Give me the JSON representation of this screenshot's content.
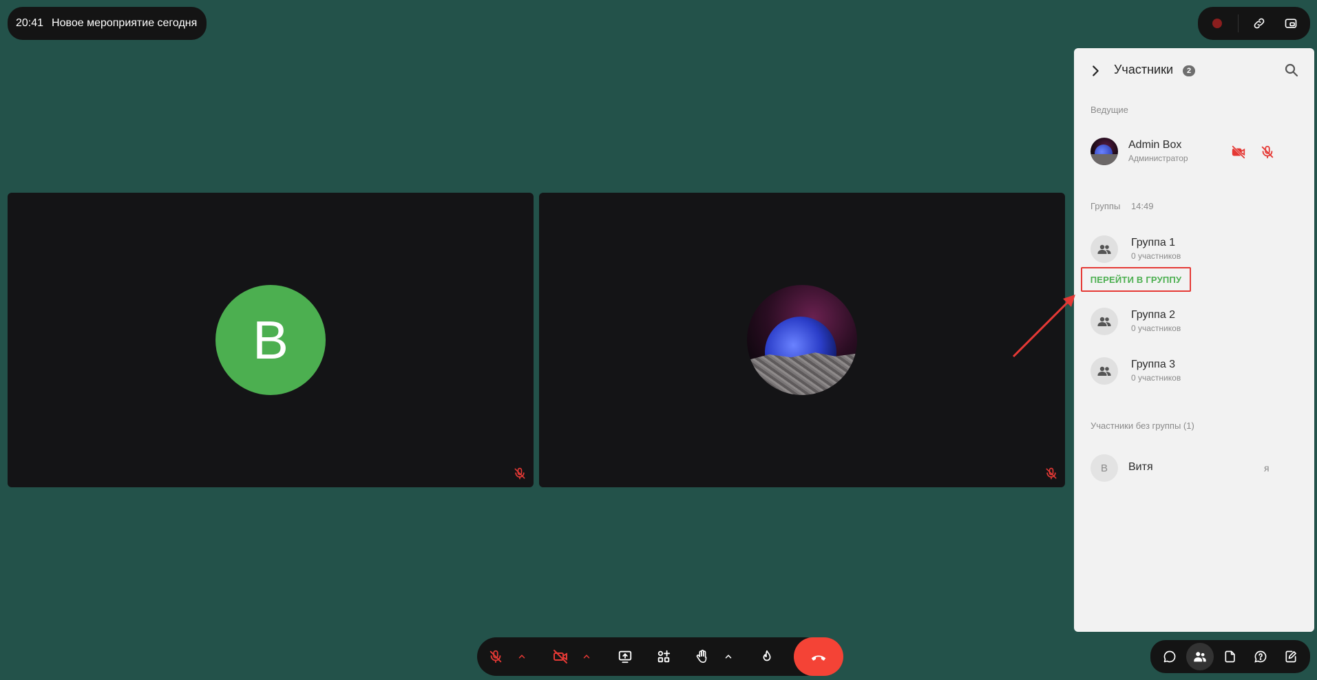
{
  "header": {
    "time": "20:41",
    "title": "Новое мероприятие сегодня"
  },
  "tiles": [
    {
      "avatar_letter": "B",
      "avatar_color": "#4caf50",
      "mic_muted": true
    },
    {
      "avatar_image": "planet-image",
      "mic_muted": true
    }
  ],
  "panel": {
    "title": "Участники",
    "count": "2",
    "hosts_title": "Ведущие",
    "host": {
      "name": "Admin Box",
      "role": "Администратор"
    },
    "groups_title": "Группы",
    "groups_timer": "14:49",
    "groups": [
      {
        "name": "Группа 1",
        "members": "0 участников"
      },
      {
        "name": "Группа 2",
        "members": "0 участников"
      },
      {
        "name": "Группа 3",
        "members": "0 участников"
      }
    ],
    "goto_group_label": "ПЕРЕЙТИ В ГРУППУ",
    "ungrouped_title": "Участники без группы (1)",
    "ungrouped": [
      {
        "initial": "В",
        "name": "Витя",
        "me_label": "я"
      }
    ]
  },
  "colors": {
    "background": "#23524a",
    "muted_red": "#e53935",
    "accent_green": "#4caf50",
    "end_call": "#f44336"
  },
  "icons": {
    "top_right": [
      "record-icon",
      "link-icon",
      "picture-in-picture-icon"
    ],
    "controls": [
      "mic-off-icon",
      "camera-off-icon",
      "screen-share-icon",
      "apps-icon",
      "raise-hand-icon",
      "reaction-icon",
      "more-icon",
      "end-call-icon"
    ],
    "bottom_right": [
      "chat-icon",
      "participants-icon",
      "files-icon",
      "help-icon",
      "notes-icon"
    ]
  }
}
